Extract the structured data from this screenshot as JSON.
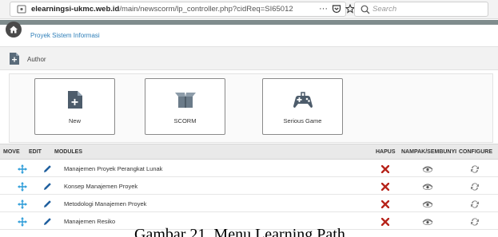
{
  "browser": {
    "url_host": "elearningsi-ukmc.web.id",
    "url_path": "/main/newscorm/lp_controller.php?cidReq=SI65012",
    "more_label": "···",
    "search_placeholder": "Search"
  },
  "header": {
    "breadcrumb": "Proyek Sistem Informasi"
  },
  "author_bar": {
    "label": "Author"
  },
  "cards": [
    {
      "label": "New",
      "icon": "new-document-icon"
    },
    {
      "label": "SCORM",
      "icon": "scorm-package-icon"
    },
    {
      "label": "Serious Game",
      "icon": "gamepad-icon"
    }
  ],
  "table": {
    "headers": {
      "move": "MOVE",
      "edit": "EDIT",
      "modules": "MODULES",
      "hapus": "HAPUS",
      "nampak": "NAMPAK/SEMBUNYI",
      "configure": "CONFIGURE"
    },
    "rows": [
      {
        "title": "Manajemen Proyek Perangkat Lunak"
      },
      {
        "title": "Konsep Manajemen Proyek"
      },
      {
        "title": "Metodologi Manajemen Proyek"
      },
      {
        "title": "Manajemen Resiko"
      }
    ]
  },
  "caption": "Gambar 21. Menu Learning Path",
  "colors": {
    "move": "#2a9bd8",
    "edit": "#1f5f9e",
    "delete": "#b7241b",
    "visibility": "#666666",
    "configure": "#888888"
  }
}
